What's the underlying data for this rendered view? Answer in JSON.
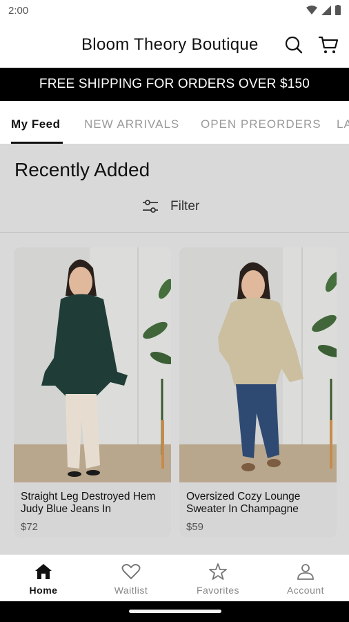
{
  "status": {
    "time": "2:00"
  },
  "header": {
    "title": "Bloom Theory Boutique"
  },
  "banner": {
    "text": "FREE SHIPPING FOR ORDERS OVER $150"
  },
  "tabs": [
    {
      "label": "My Feed"
    },
    {
      "label": "NEW ARRIVALS"
    },
    {
      "label": "OPEN PREORDERS"
    },
    {
      "label": "LA"
    }
  ],
  "section": {
    "title": "Recently Added",
    "filter_label": "Filter"
  },
  "products": [
    {
      "name": "Straight Leg Destroyed Hem Judy Blue Jeans In",
      "price": "$72",
      "top_color": "#1f3d36",
      "pants_color": "#e6ddd0"
    },
    {
      "name": "Oversized Cozy Lounge Sweater In Champagne",
      "price": "$59",
      "top_color": "#cbbf9f",
      "pants_color": "#2f4a72"
    }
  ],
  "nav": [
    {
      "label": "Home",
      "icon": "home-icon"
    },
    {
      "label": "Waitlist",
      "icon": "heart-icon"
    },
    {
      "label": "Favorites",
      "icon": "star-icon"
    },
    {
      "label": "Account",
      "icon": "person-icon"
    }
  ]
}
